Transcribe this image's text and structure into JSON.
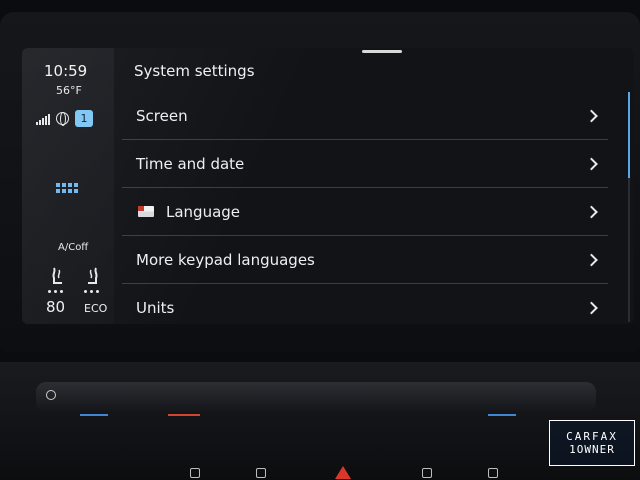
{
  "status": {
    "time": "10:59",
    "outside_temp": "56°F",
    "badge_count": "1"
  },
  "climate": {
    "ac_label": "A/Coff",
    "set_temp": "80",
    "mode": "ECO"
  },
  "page": {
    "title": "System settings"
  },
  "settings_items": [
    {
      "label": "Screen",
      "icon": ""
    },
    {
      "label": "Time and date",
      "icon": ""
    },
    {
      "label": "Language",
      "icon": "flag-icon"
    },
    {
      "label": "More keypad languages",
      "icon": ""
    },
    {
      "label": "Units",
      "icon": ""
    }
  ],
  "watermark": {
    "top": "CARFAX",
    "bottom": "1OWNER"
  },
  "colors": {
    "accent": "#7ec6f5",
    "hazard": "#d8382c"
  }
}
